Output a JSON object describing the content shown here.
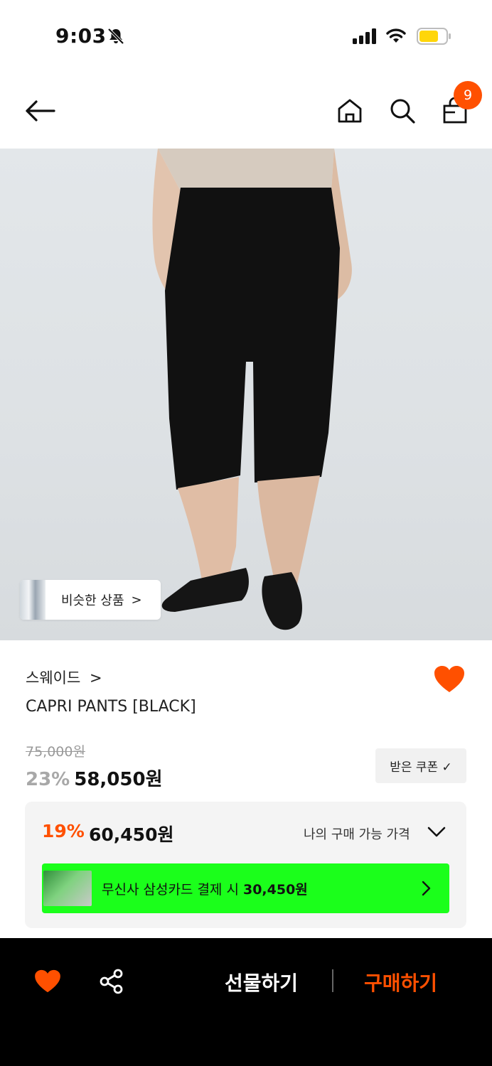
{
  "status_bar": {
    "time": "9:03"
  },
  "nav": {
    "cart_count": "9"
  },
  "image": {
    "similar_label": "비슷한 상품",
    "similar_chevron": ">"
  },
  "product": {
    "brand": "스웨이드",
    "brand_chevron": ">",
    "name": "CAPRI PANTS [BLACK]",
    "original_price": "75,000원",
    "discount_percent": "23%",
    "sale_price": "58,050원",
    "coupon_label": "받은 쿠폰 ✓"
  },
  "member_price": {
    "percent": "19%",
    "price": "60,450원",
    "label": "나의 구매 가능 가격",
    "card_offer_prefix": "무신사 삼성카드 결제 시 ",
    "card_offer_price": "30,450원"
  },
  "bottom_bar": {
    "gift_label": "선물하기",
    "buy_label": "구매하기"
  },
  "colors": {
    "accent": "#ff5000",
    "card_green": "#1bff1b",
    "bottom_bg": "#000000"
  }
}
